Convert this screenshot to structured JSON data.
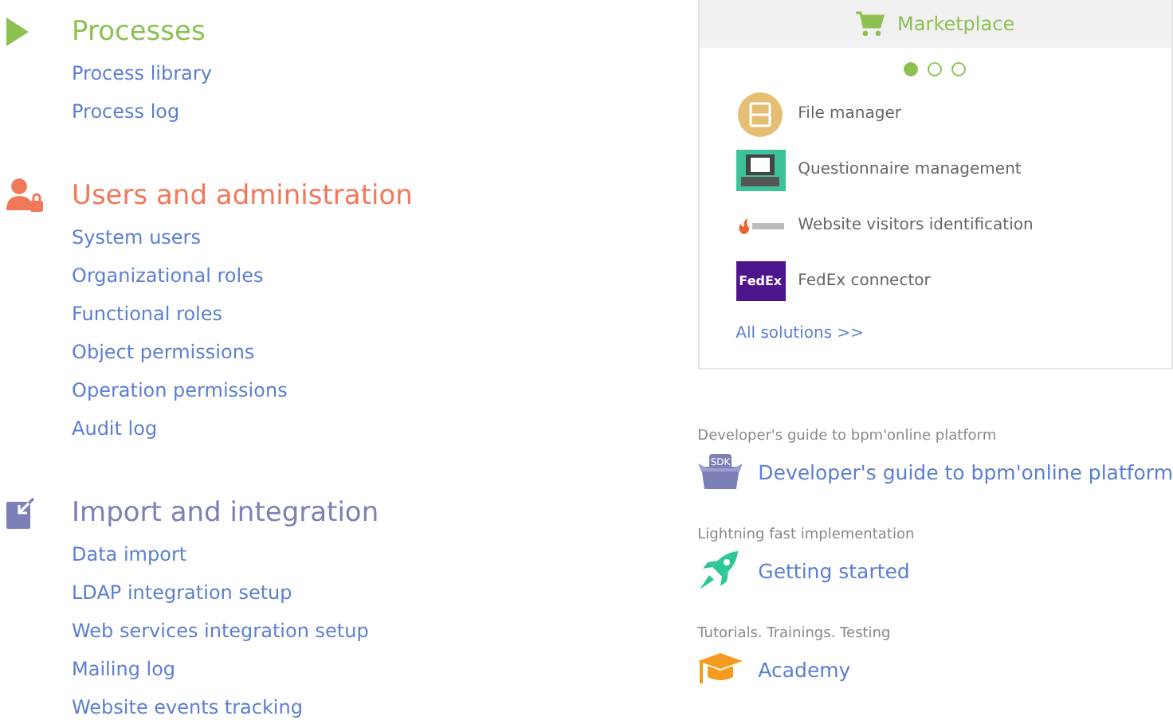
{
  "sections": [
    {
      "kind": "processes",
      "title": "Processes",
      "links": [
        "Process library",
        "Process log"
      ]
    },
    {
      "kind": "users",
      "title": "Users and administration",
      "links": [
        "System users",
        "Organizational roles",
        "Functional roles",
        "Object permissions",
        "Operation permissions",
        "Audit log"
      ]
    },
    {
      "kind": "import",
      "title": "Import and integration",
      "links": [
        "Data import",
        "LDAP integration setup",
        "Web services integration setup",
        "Mailing log",
        "Website events tracking"
      ]
    }
  ],
  "marketplace": {
    "title": "Marketplace",
    "pages": [
      {
        "selected": true
      },
      {
        "selected": false
      },
      {
        "selected": false
      }
    ],
    "items": [
      {
        "kind": "file",
        "name": "File manager"
      },
      {
        "kind": "questionnaire",
        "name": "Questionnaire management"
      },
      {
        "kind": "kickfire",
        "name": "Website visitors identification"
      },
      {
        "kind": "fedex",
        "name": "FedEx connector",
        "logo_text": "FedEx"
      }
    ],
    "all_link": "All solutions >>"
  },
  "resources": [
    {
      "kind": "sdk",
      "caption": "Developer's guide to bpm'online platform",
      "link": "Developer's guide to bpm'online platform",
      "badge": "SDK"
    },
    {
      "kind": "rocket",
      "caption": "Lightning fast implementation",
      "link": "Getting started"
    },
    {
      "kind": "academy",
      "caption": "Tutorials. Trainings. Testing",
      "link": "Academy"
    }
  ]
}
